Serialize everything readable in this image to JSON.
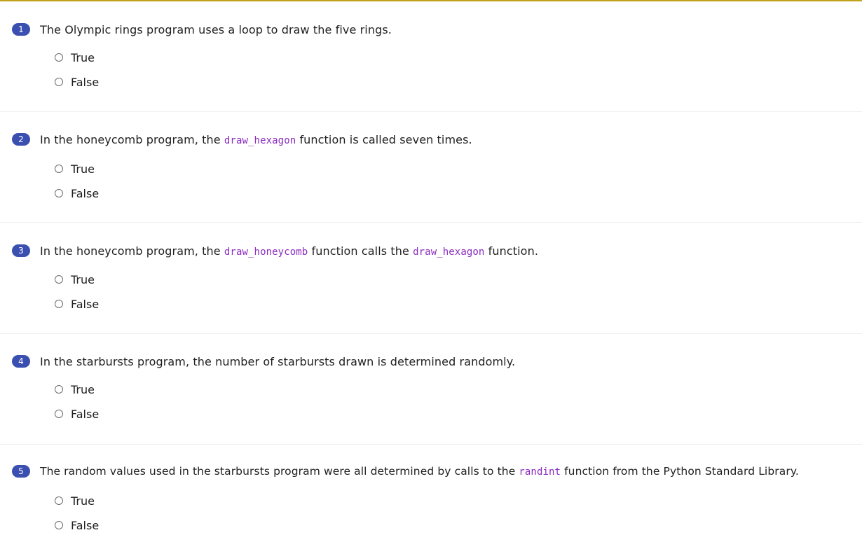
{
  "questions": [
    {
      "number": "1",
      "parts": [
        {
          "text": "The Olympic rings program uses a loop to draw the five rings."
        }
      ],
      "options": [
        "True",
        "False"
      ]
    },
    {
      "number": "2",
      "parts": [
        {
          "text": "In the honeycomb program, the "
        },
        {
          "code": "draw_hexagon"
        },
        {
          "text": " function is called seven times."
        }
      ],
      "options": [
        "True",
        "False"
      ]
    },
    {
      "number": "3",
      "parts": [
        {
          "text": "In the honeycomb program, the "
        },
        {
          "code": "draw_honeycomb"
        },
        {
          "text": " function calls the "
        },
        {
          "code": "draw_hexagon"
        },
        {
          "text": " function."
        }
      ],
      "options": [
        "True",
        "False"
      ]
    },
    {
      "number": "4",
      "parts": [
        {
          "text": "In the starbursts program, the number of starbursts drawn is determined randomly."
        }
      ],
      "options": [
        "True",
        "False"
      ]
    },
    {
      "number": "5",
      "parts": [
        {
          "text": "The random values used in the starbursts program were all determined by calls to the "
        },
        {
          "code": "randint"
        },
        {
          "text": " function from the Python Standard Library."
        }
      ],
      "options": [
        "True",
        "False"
      ]
    }
  ],
  "colors": {
    "badge": "#3a4fb0",
    "code": "#8a2bbf",
    "top_border": "#c2a21a"
  }
}
